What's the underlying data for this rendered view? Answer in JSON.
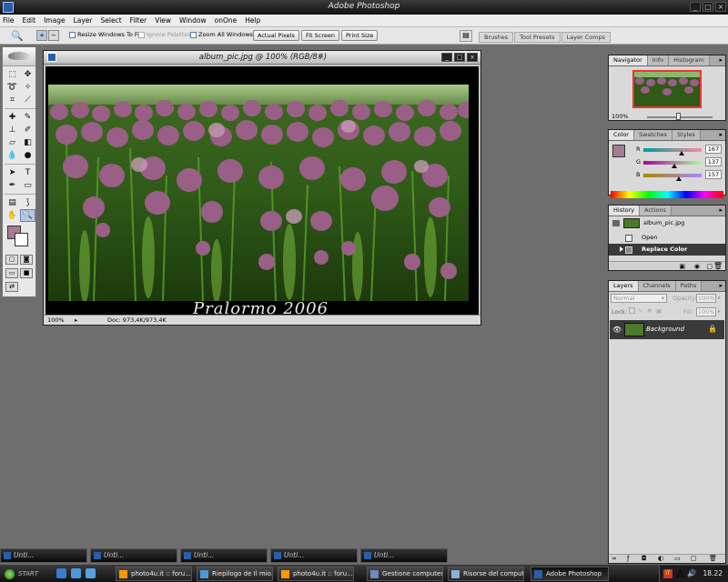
{
  "app": {
    "title": "Adobe Photoshop",
    "window_buttons": [
      "_",
      "□",
      "×"
    ]
  },
  "menu": [
    "File",
    "Edit",
    "Image",
    "Layer",
    "Select",
    "Filter",
    "View",
    "Window",
    "onOne",
    "Help"
  ],
  "options_bar": {
    "checkboxes": [
      {
        "label": "Resize Windows To Fit",
        "checked": false,
        "enabled": true
      },
      {
        "label": "Ignore Palettes",
        "checked": false,
        "enabled": false
      },
      {
        "label": "Zoom All Windows",
        "checked": false,
        "enabled": true
      }
    ],
    "buttons": [
      "Actual Pixels",
      "Fit Screen",
      "Print Size"
    ],
    "palette_well_tabs": [
      "Brushes",
      "Tool Presets",
      "Layer Comps"
    ]
  },
  "toolbox": {
    "tools": [
      "marquee-tool",
      "move-tool",
      "lasso-tool",
      "magic-wand-tool",
      "crop-tool",
      "slice-tool",
      "healing-brush-tool",
      "brush-tool",
      "clone-stamp-tool",
      "history-brush-tool",
      "eraser-tool",
      "gradient-tool",
      "blur-tool",
      "dodge-tool",
      "path-selection-tool",
      "type-tool",
      "pen-tool",
      "shape-tool",
      "notes-tool",
      "eyedropper-tool",
      "hand-tool",
      "zoom-tool"
    ],
    "active_tool": "zoom-tool",
    "foreground_color": "#a77b92",
    "background_color": "#ffffff"
  },
  "document": {
    "title": "album_pic.jpg @ 100% (RGB/8#)",
    "watermark": "Pralormo 2006",
    "zoom": "100%",
    "doc_size": "Doc: 973,4K/973,4K"
  },
  "navigator": {
    "tabs": [
      "Navigator",
      "Info",
      "Histogram"
    ],
    "zoom": "100%"
  },
  "color": {
    "tabs": [
      "Color",
      "Swatches",
      "Styles"
    ],
    "r": {
      "label": "R",
      "value": "167"
    },
    "g": {
      "label": "G",
      "value": "137"
    },
    "b": {
      "label": "B",
      "value": "157"
    },
    "swatch": "#a77b92"
  },
  "history": {
    "tabs": [
      "History",
      "Actions"
    ],
    "snapshot": "album_pic.jpg",
    "states": [
      "Open",
      "Replace Color"
    ],
    "selected": "Replace Color"
  },
  "layers": {
    "tabs": [
      "Layers",
      "Channels",
      "Paths"
    ],
    "blend_mode": "Normal",
    "opacity_label": "Opacity:",
    "opacity": "100%",
    "lock_label": "Lock:",
    "fill_label": "Fill:",
    "fill": "100%",
    "layer_name": "Background"
  },
  "minimized_docs": [
    "Unti...",
    "Unti...",
    "Unti...",
    "Unti...",
    "Unti..."
  ],
  "taskbar": {
    "start": "START",
    "items": [
      {
        "label": "photo4u.it :: foru...",
        "active": false
      },
      {
        "label": "Riepilogo de Il mio...",
        "active": false
      },
      {
        "label": "photo4u.it :: foru...",
        "active": false
      },
      {
        "label": "Gestione computer",
        "active": false
      },
      {
        "label": "Risorse del computer",
        "active": false
      },
      {
        "label": "Adobe Photoshop",
        "active": true
      }
    ],
    "lang": "IT",
    "clock": "18.22"
  }
}
